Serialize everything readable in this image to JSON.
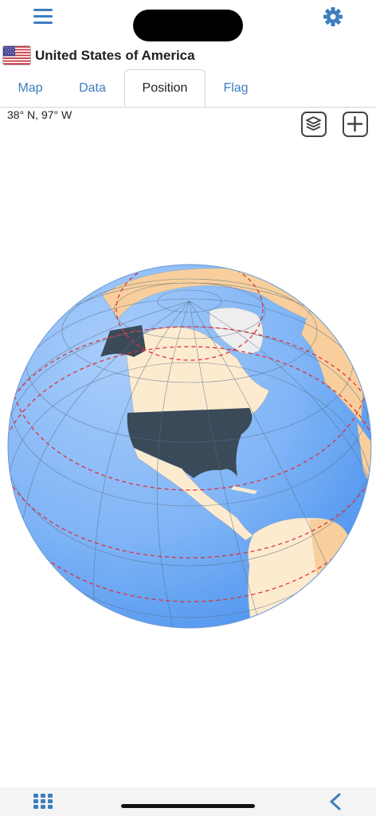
{
  "header": {
    "menu_icon": "hamburger-menu-icon",
    "settings_icon": "gear-icon"
  },
  "country": {
    "name": "United States of America",
    "flag_icon": "us-flag-icon"
  },
  "tabs": [
    {
      "label": "Map",
      "active": false
    },
    {
      "label": "Data",
      "active": false
    },
    {
      "label": "Position",
      "active": true
    },
    {
      "label": "Flag",
      "active": false
    }
  ],
  "position": {
    "coordinates": "38° N, 97° W",
    "layers_icon": "layers-icon",
    "zoom_icon": "plus-icon"
  },
  "colors": {
    "accent": "#3d7ebf",
    "ocean": "#6fa9f2",
    "land": "#fdebd0",
    "land_other": "#f8cf9c",
    "highlight": "#3a4a58",
    "greenland": "#eeeeee",
    "tropic_lines": "#e0303a"
  },
  "footer": {
    "grid_icon": "grid-icon",
    "back_icon": "chevron-left-icon"
  }
}
